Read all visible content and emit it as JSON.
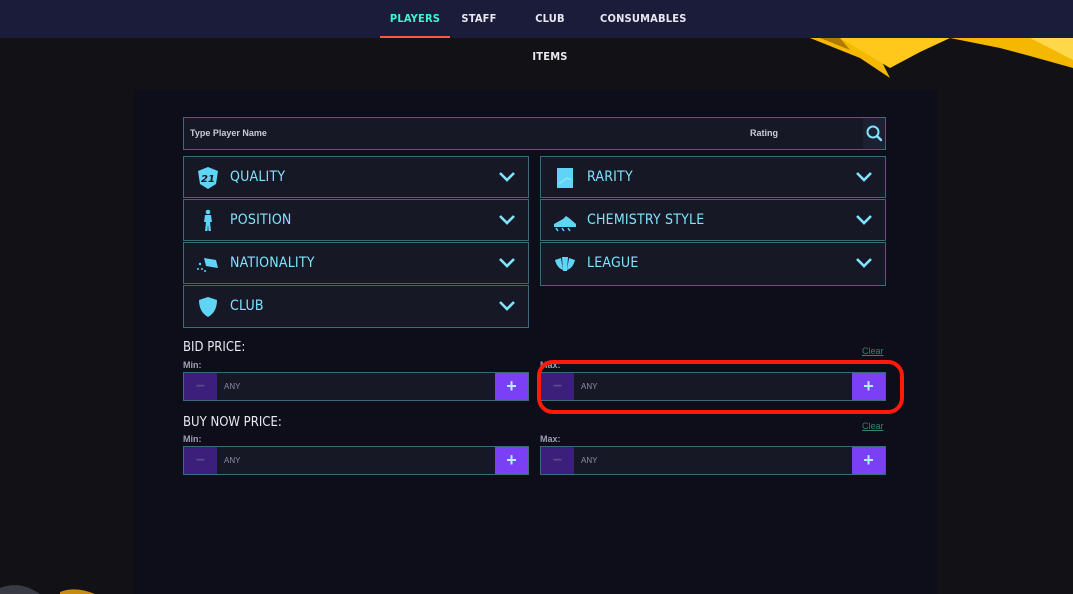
{
  "nav": {
    "tabs": [
      {
        "label": "PLAYERS",
        "active": true
      },
      {
        "label": "STAFF",
        "active": false
      },
      {
        "label": "CLUB ITEMS",
        "active": false
      },
      {
        "label": "CONSUMABLES",
        "active": false
      }
    ]
  },
  "search": {
    "player_name_placeholder": "Type Player Name",
    "rating_placeholder": "Rating",
    "icon": "search-icon"
  },
  "filters": {
    "quality": {
      "label": "QUALITY",
      "icon": "quality-badge-icon",
      "badge_text": "21"
    },
    "position": {
      "label": "POSITION",
      "icon": "player-figure-icon"
    },
    "nationality": {
      "label": "NATIONALITY",
      "icon": "flag-icon"
    },
    "club": {
      "label": "CLUB",
      "icon": "shield-icon"
    },
    "rarity": {
      "label": "RARITY",
      "icon": "card-icon"
    },
    "chemistry_style": {
      "label": "CHEMISTRY STYLE",
      "icon": "boot-icon"
    },
    "league": {
      "label": "LEAGUE",
      "icon": "league-icon"
    }
  },
  "bid_price": {
    "title": "BID PRICE:",
    "clear_label": "Clear",
    "min_label": "Min:",
    "max_label": "Max:",
    "min_value": "ANY",
    "max_value": "ANY"
  },
  "buy_now_price": {
    "title": "BUY NOW PRICE:",
    "clear_label": "Clear",
    "min_label": "Min:",
    "max_label": "Max:",
    "min_value": "ANY",
    "max_value": "ANY"
  },
  "stepper_symbols": {
    "minus": "−",
    "plus": "+"
  },
  "colors": {
    "accent_teal": "#3ff5d0",
    "label_cyan": "#7fe3ff",
    "plus_purple": "#7b3ff5",
    "minus_purple": "#3b1f7a",
    "highlight_red": "#ff1a0a",
    "nav_underline": "#ff5a3c"
  }
}
